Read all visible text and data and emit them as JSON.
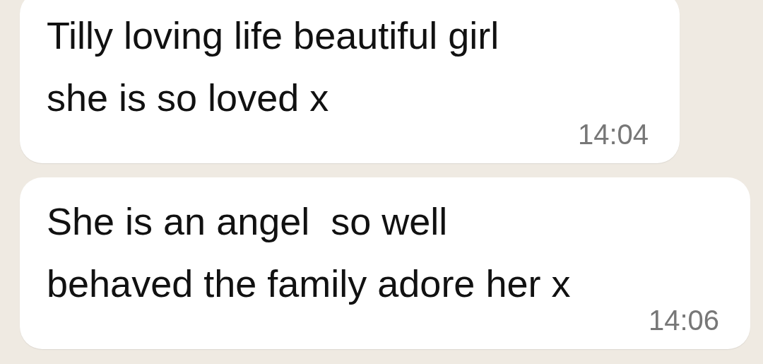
{
  "messages": [
    {
      "text": "Tilly loving life beautiful girl\nshe is so loved x",
      "time": "14:04"
    },
    {
      "text": "She is an angel  so well\nbehaved the family adore her x",
      "time": "14:06"
    }
  ]
}
